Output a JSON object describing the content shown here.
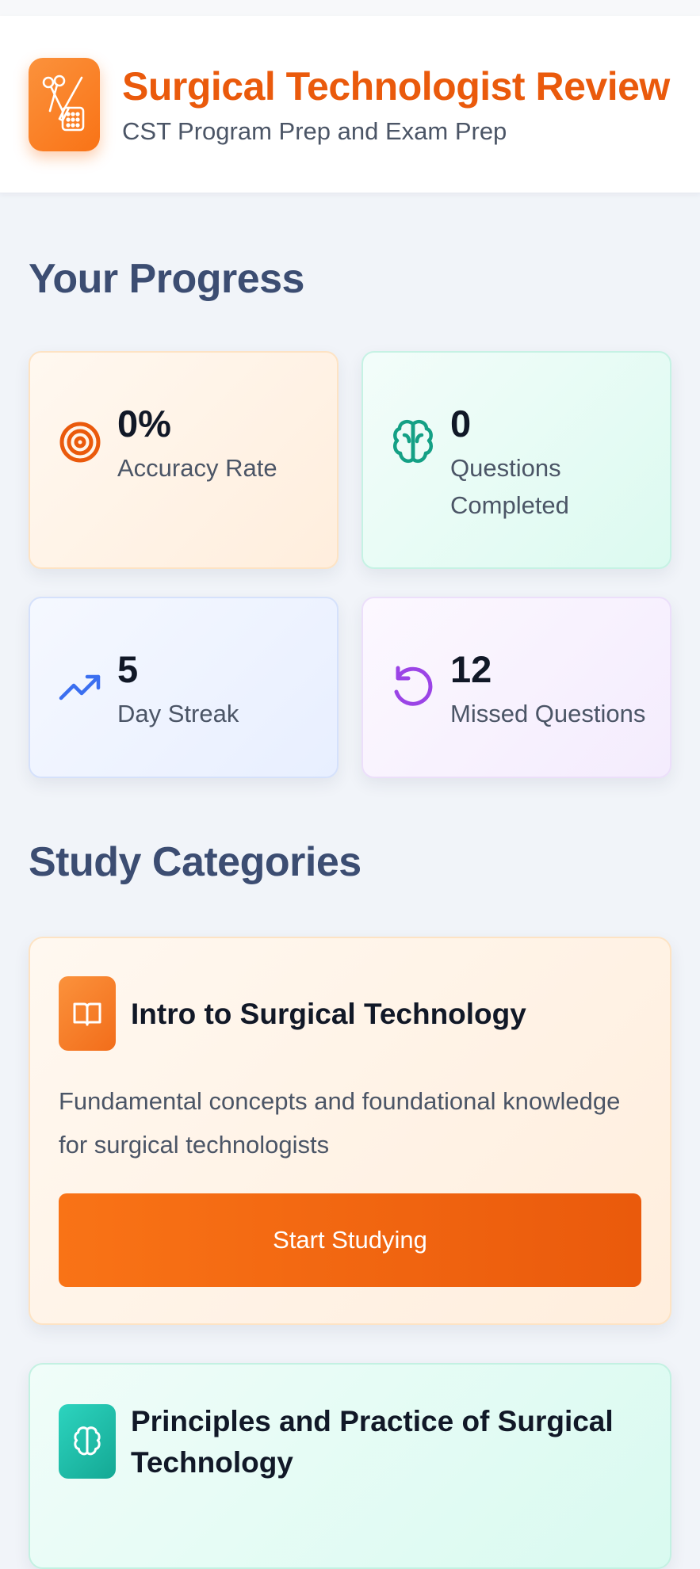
{
  "header": {
    "title": "Surgical Technologist Review",
    "subtitle": "CST Program Prep and Exam Prep",
    "logo_icon": "surgical-tools-icon"
  },
  "progress": {
    "heading": "Your Progress",
    "stats": [
      {
        "value": "0%",
        "label": "Accuracy Rate",
        "icon": "target-icon",
        "color": "#ea5a0c"
      },
      {
        "value": "0",
        "label": "Questions Completed",
        "icon": "brain-icon",
        "color": "#14a085"
      },
      {
        "value": "5",
        "label": "Day Streak",
        "icon": "trending-up-icon",
        "color": "#3b6ff0"
      },
      {
        "value": "12",
        "label": "Missed Questions",
        "icon": "rotate-ccw-icon",
        "color": "#9b44e6"
      }
    ]
  },
  "categories": {
    "heading": "Study Categories",
    "items": [
      {
        "title": "Intro to Surgical Technology",
        "description": "Fundamental concepts and foundational knowledge for surgical technologists",
        "button": "Start Studying",
        "icon": "book-open-icon",
        "color": "#f97316"
      },
      {
        "title": "Principles and Practice of Surgical Technology",
        "icon": "brain-icon",
        "color": "#14b8a6"
      }
    ]
  },
  "colors": {
    "accent": "#ea5a0c",
    "heading": "#3c4d72"
  }
}
